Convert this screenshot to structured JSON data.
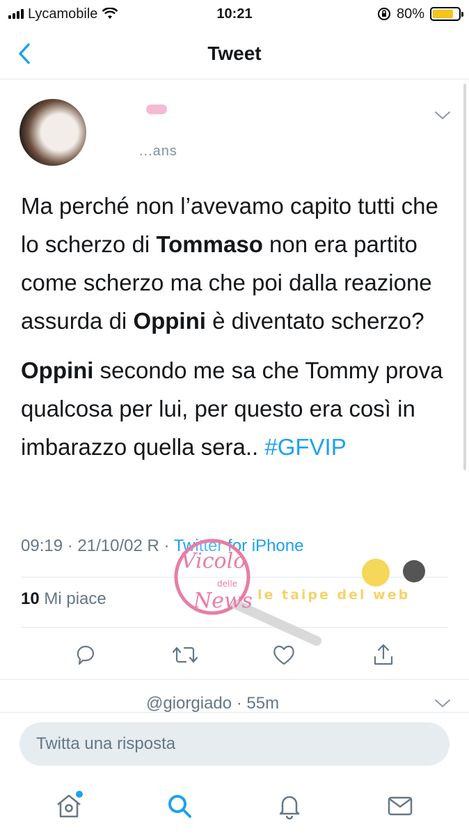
{
  "status_bar": {
    "carrier": "Lycamobile",
    "time": "10:21",
    "battery_percent": "80%",
    "battery_level": 0.8,
    "battery_color": "#f5c518"
  },
  "nav": {
    "back_icon": "chevron-left-icon",
    "title": "Tweet"
  },
  "tweet": {
    "author_handle_partial": "...ans",
    "para1": {
      "a": "Ma perché non l’avevamo capito tutti che lo scherzo di ",
      "b": "Tommaso",
      "c": " non era partito come scherzo ma che poi dalla reazione assurda di ",
      "d": "Oppini",
      "e": " è diventato scherzo?"
    },
    "para2": {
      "a": "Oppini",
      "b": " secondo me sa che Tommy prova qualcosa per lui, per questo era così in imbarazzo quella sera.. ",
      "hashtag": "#GFVIP"
    },
    "meta_time": "09:19 · 21/10/02 R · ",
    "meta_source": "Twitter for iPhone",
    "likes_count": "10",
    "likes_label": " Mi piace"
  },
  "actions": [
    "reply-icon",
    "retweet-icon",
    "like-icon",
    "share-icon"
  ],
  "next_tweet": {
    "preview": "@giorgiado · 55m"
  },
  "reply": {
    "placeholder": "Twitta una risposta"
  },
  "tab_bar": [
    "home-icon",
    "search-icon",
    "notifications-icon",
    "messages-icon"
  ],
  "watermark": {
    "text1": "Vicolo",
    "text2": "delle",
    "text3": "News",
    "text4": "le taipe del web"
  },
  "colors": {
    "accent": "#1da1f2",
    "text": "#14171a",
    "muted": "#657786"
  }
}
